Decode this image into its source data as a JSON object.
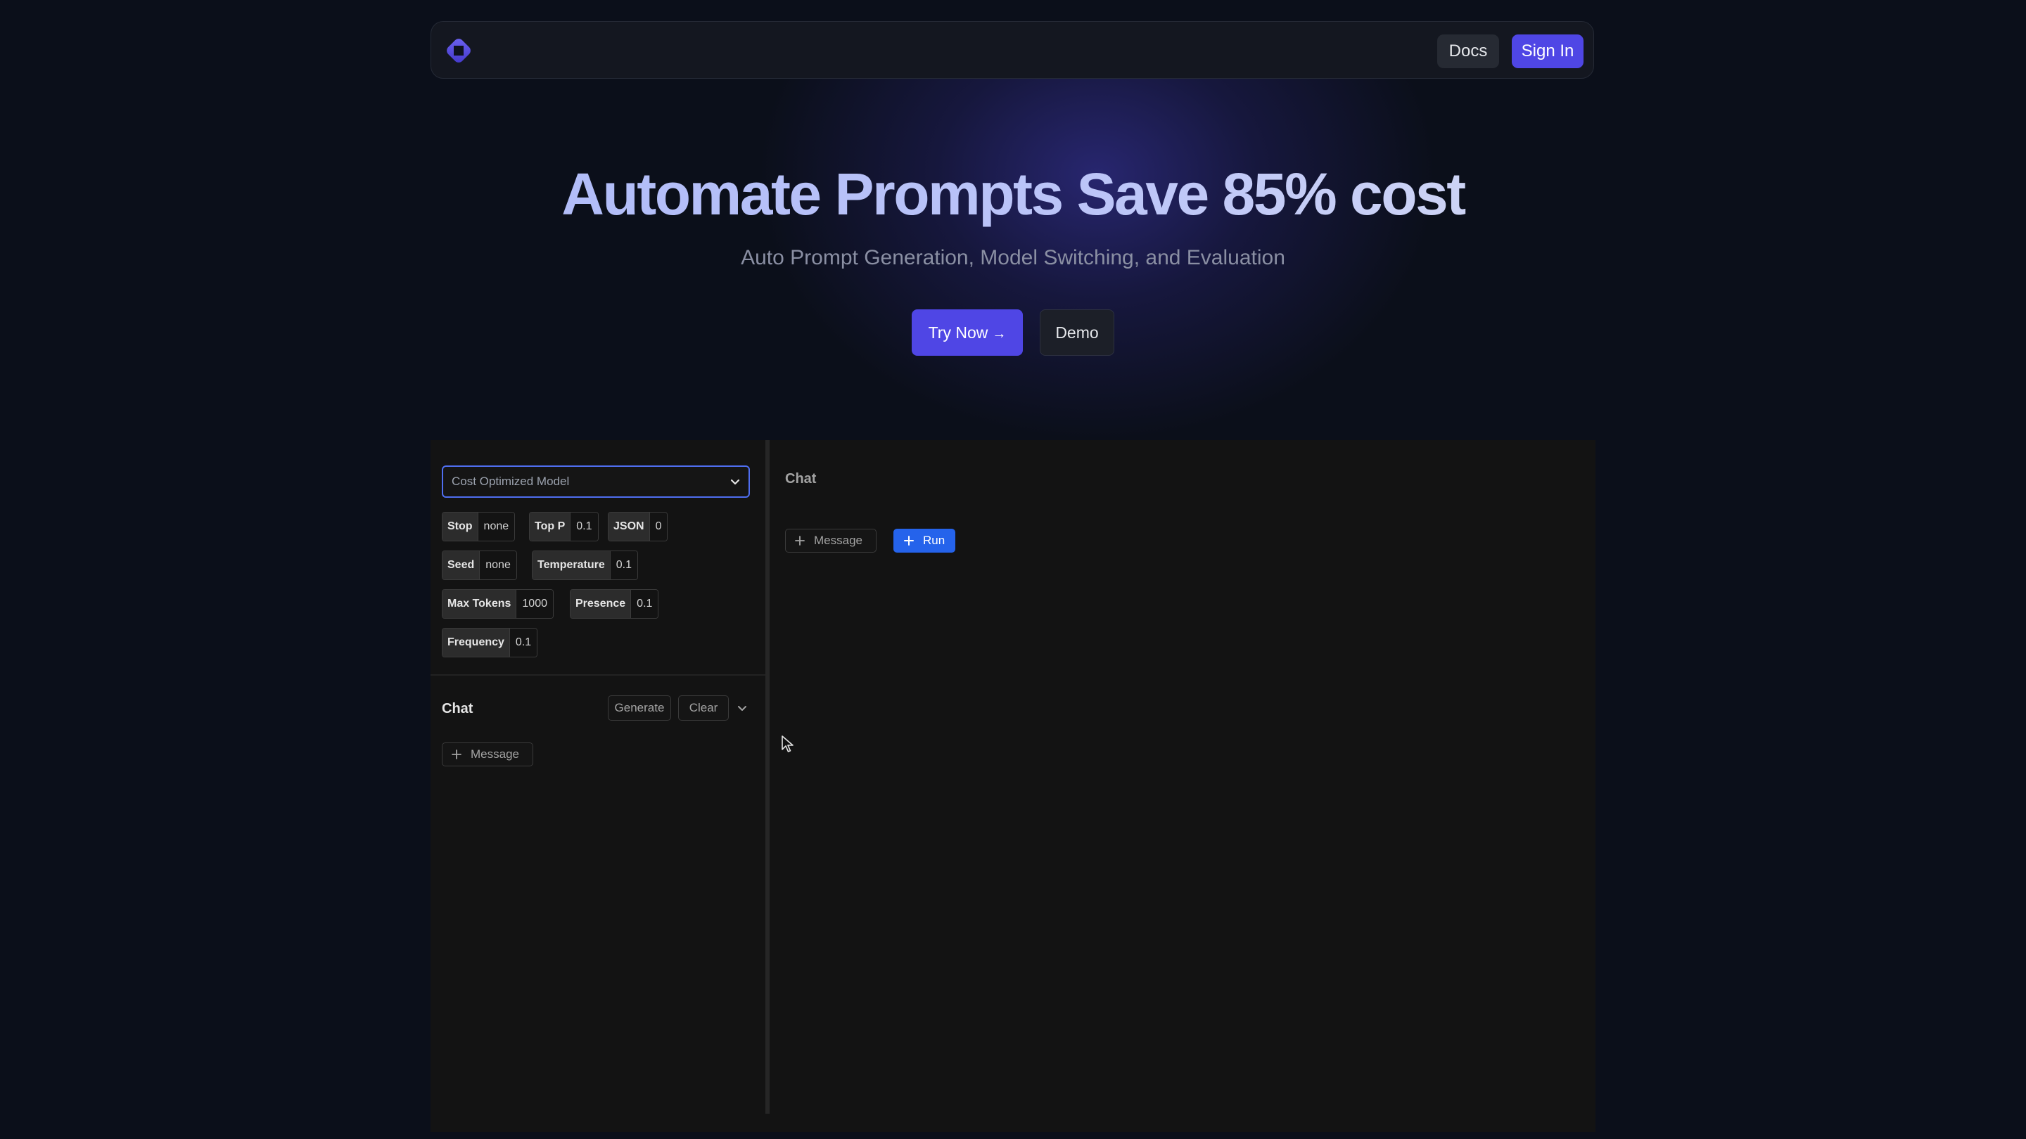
{
  "colors": {
    "background": "#0b0f1a",
    "accent": "#4f46e5",
    "run_blue": "#2563eb",
    "select_border": "#4f6ef0",
    "panel": "#131313"
  },
  "navbar": {
    "logo_icon": "diamond-logo-icon",
    "docs_label": "Docs",
    "signin_label": "Sign In"
  },
  "hero": {
    "title": "Automate Prompts Save 85% cost",
    "subtitle": "Auto Prompt Generation, Model Switching, and Evaluation",
    "try_label": "Try Now",
    "try_icon": "arrow-right-icon",
    "demo_label": "Demo"
  },
  "playground": {
    "model_select": {
      "value": "Cost Optimized Model",
      "icon": "chevron-down-icon"
    },
    "params": [
      {
        "name": "Stop",
        "value": "none"
      },
      {
        "name": "Top P",
        "value": "0.1"
      },
      {
        "name": "JSON",
        "value": "0"
      },
      {
        "name": "Seed",
        "value": "none"
      },
      {
        "name": "Temperature",
        "value": "0.1"
      },
      {
        "name": "Max Tokens",
        "value": "1000"
      },
      {
        "name": "Presence",
        "value": "0.1"
      },
      {
        "name": "Frequency",
        "value": "0.1"
      }
    ],
    "left_chat": {
      "title": "Chat",
      "generate_label": "Generate",
      "clear_label": "Clear",
      "message_label": "Message"
    },
    "right_chat": {
      "title": "Chat",
      "message_label": "Message",
      "run_label": "Run"
    }
  }
}
